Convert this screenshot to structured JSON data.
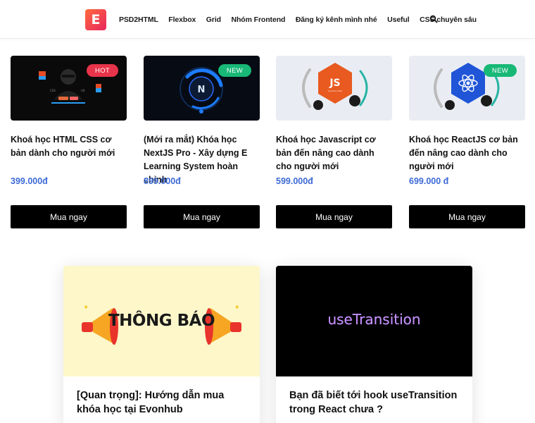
{
  "header": {
    "logo_letter": "E",
    "nav": [
      "PSD2HTML",
      "Flexbox",
      "Grid",
      "Nhóm Frontend",
      "Đăng ký kênh mình nhé",
      "Useful",
      "CSS chuyên sâu"
    ]
  },
  "courses": [
    {
      "badge": "HOT",
      "title": "Khoá học HTML CSS cơ bản dành cho người mới",
      "price": "399.000đ",
      "button": "Mua ngay",
      "thumb_bg": "#0a0a0a"
    },
    {
      "badge": "NEW",
      "title": "(Mới ra mắt) Khóa học NextJS Pro - Xây dựng E Learning System hoàn chỉnh",
      "price": "899.000đ",
      "button": "Mua ngay",
      "thumb_bg": "#070b14"
    },
    {
      "badge": "",
      "title": "Khoá học Javascript cơ bản đến nâng cao dành cho người mới",
      "price": "599.000đ",
      "button": "Mua ngay",
      "thumb_bg": "#e9edf3"
    },
    {
      "badge": "NEW",
      "title": "Khoá học ReactJS cơ bản đến nâng cao dành cho người mới",
      "price": "699.000 đ",
      "button": "Mua ngay",
      "thumb_bg": "#e9edf3"
    }
  ],
  "blog_posts": [
    {
      "image_text": "THÔNG BÁO",
      "title": "[Quan trọng]: Hướng dẫn mua khóa học tại Evonhub"
    },
    {
      "image_text": "useTransition",
      "title": "Bạn đã biết tới hook useTransition trong React chưa ?"
    }
  ],
  "colors": {
    "price": "#3d6ad6",
    "hot": "#e8344a",
    "new": "#18b877",
    "button": "#000000",
    "logo": "#ef3d4f"
  }
}
